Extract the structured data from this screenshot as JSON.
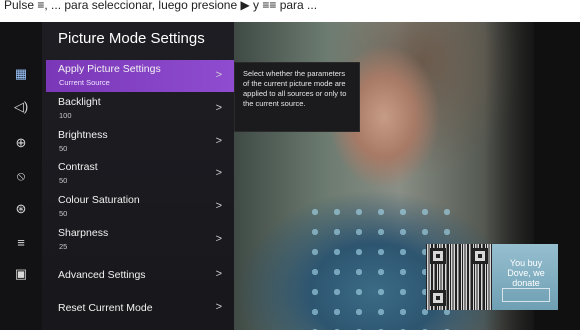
{
  "caption": {
    "text": "Pulse ≡, ... para seleccionar, luego presione ▶ y ≡≡ para ..."
  },
  "rail": {
    "icons": [
      {
        "name": "picture-icon",
        "glyph": "▦",
        "active": true
      },
      {
        "name": "sound-icon",
        "glyph": "◁)"
      },
      {
        "name": "network-icon",
        "glyph": "⊕"
      },
      {
        "name": "channel-icon",
        "glyph": "⦸"
      },
      {
        "name": "accessibility-icon",
        "glyph": "⊛"
      },
      {
        "name": "general-icon",
        "glyph": "≡"
      },
      {
        "name": "support-icon",
        "glyph": "▣"
      }
    ]
  },
  "panel": {
    "title": "Picture Mode Settings",
    "items": [
      {
        "label": "Apply Picture Settings",
        "value": "Current Source",
        "selected": true
      },
      {
        "label": "Backlight",
        "value": "100"
      },
      {
        "label": "Brightness",
        "value": "50"
      },
      {
        "label": "Contrast",
        "value": "50"
      },
      {
        "label": "Colour Saturation",
        "value": "50"
      },
      {
        "label": "Sharpness",
        "value": "25"
      },
      {
        "label": "Advanced Settings",
        "value": ""
      },
      {
        "label": "Reset Current Mode",
        "value": ""
      }
    ],
    "chevron": ">"
  },
  "tooltip": {
    "text": "Select whether the parameters of the current picture mode are applied to all sources or only to the current source."
  },
  "promo": {
    "tagline": "You buy Dove, we donate"
  }
}
